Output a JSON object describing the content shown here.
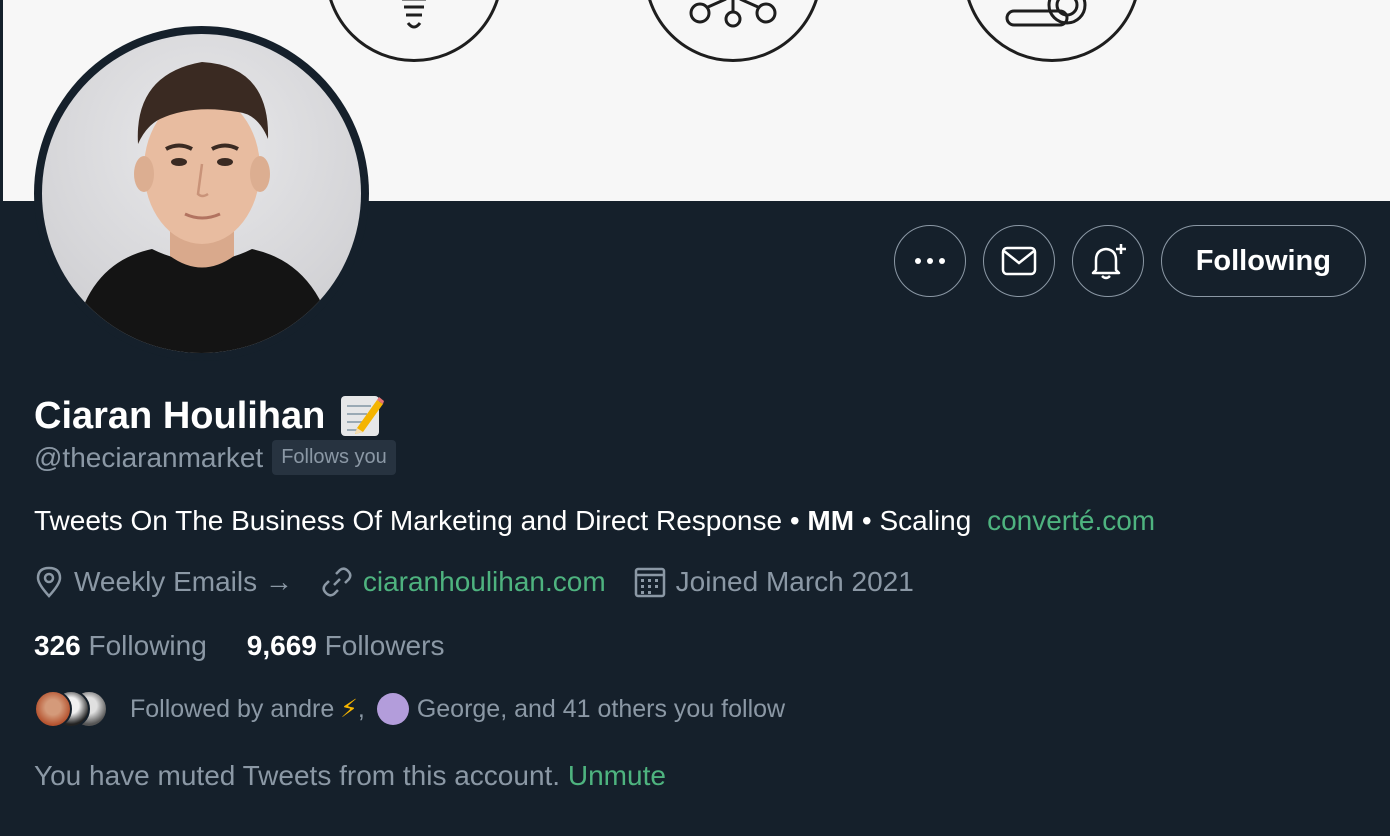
{
  "profile": {
    "name": "Ciaran Houlihan",
    "name_emoji": "memo-icon",
    "handle": "@theciaranmarket",
    "follows_you": "Follows you",
    "bio_text": "Tweets On The Business Of Marketing and Direct Response •",
    "bio_bold": "MM",
    "bio_text2": "• Scaling",
    "bio_link": "converté.com",
    "location": "Weekly Emails →",
    "website": "ciaranhoulihan.com",
    "joined": "Joined March 2021"
  },
  "stats": {
    "following_count": "326",
    "following_label": "Following",
    "followers_count": "9,669",
    "followers_label": "Followers"
  },
  "followed_by": {
    "prefix": "Followed by andre",
    "lightning": "⚡",
    "sep": ",",
    "suffix": "George, and 41 others you follow"
  },
  "muted": {
    "text": "You have muted Tweets from this account.",
    "action": "Unmute"
  },
  "actions": {
    "more": "more-icon",
    "message": "mail-icon",
    "notify": "bell-plus-icon",
    "following_label": "Following"
  },
  "colors": {
    "background": "#15202b",
    "accent_link": "#4eb37f",
    "secondary_text": "#8b98a5",
    "banner": "#f7f7f7"
  }
}
